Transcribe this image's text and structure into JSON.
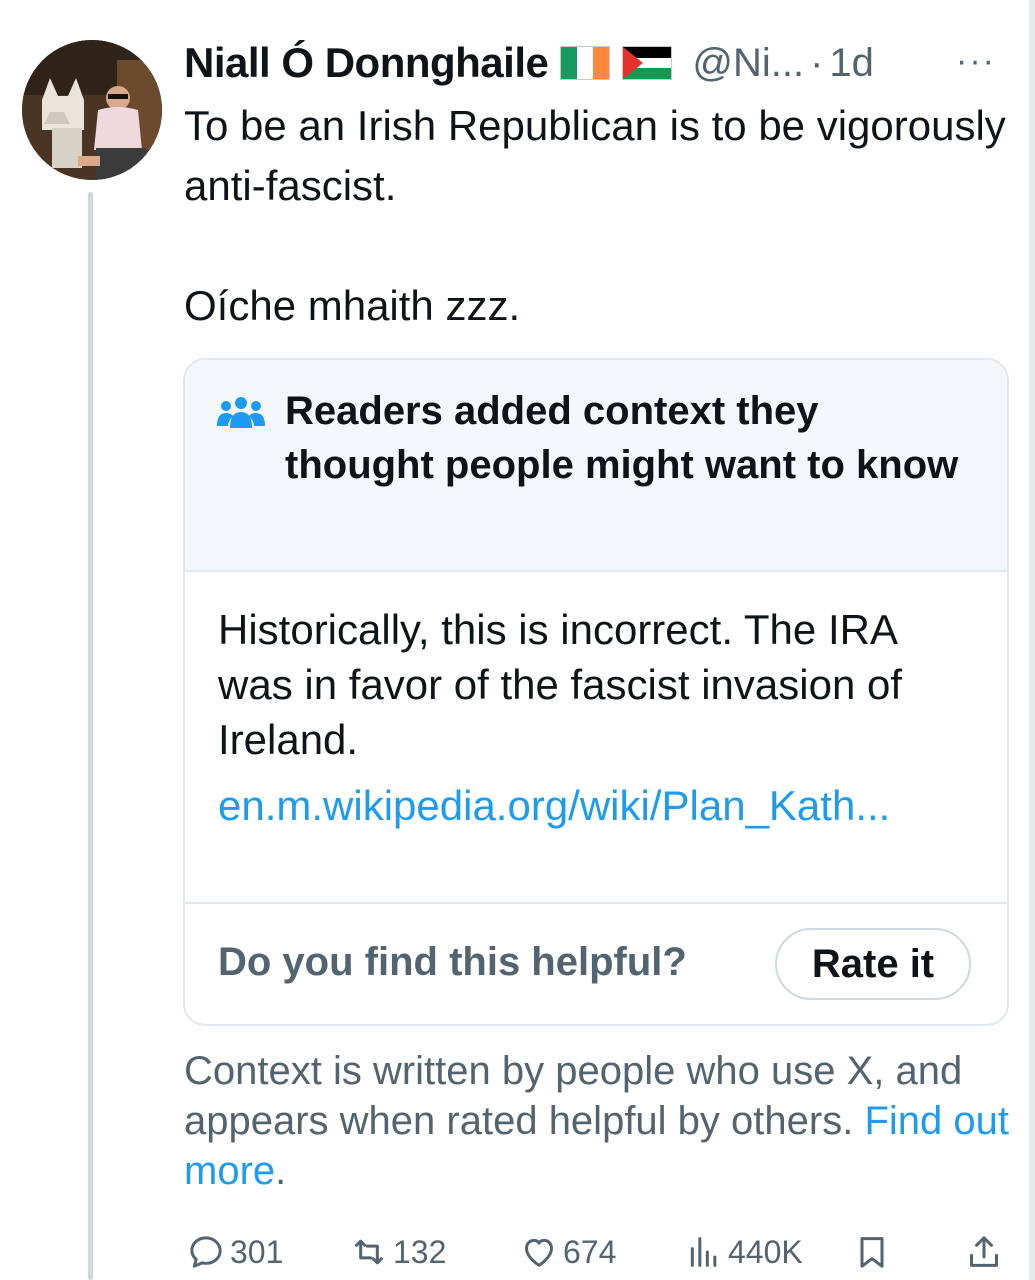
{
  "tweet": {
    "author_name": "Niall Ó Donnghaile",
    "handle": "@Ni...",
    "separator": "·",
    "time": "1d",
    "more_label": "···",
    "flags": [
      "ireland-flag",
      "palestine-flag"
    ],
    "text_line1": "To be an Irish Republican is to be vigorously anti-fascist.",
    "text_line2": "Oíche mhaith zzz."
  },
  "community_note": {
    "header_icon": "people-icon",
    "header_title": "Readers added context they thought people might want to know",
    "body_text": "Historically, this is incorrect. The IRA was in favor of the fascist invasion of Ireland.",
    "link_text": "en.m.wikipedia.org/wiki/Plan_Kath...",
    "helpful_question": "Do you find this helpful?",
    "rate_button_label": "Rate it"
  },
  "context_info": {
    "text": "Context is written by people who use X, and appears when rated helpful by others. ",
    "link_text": "Find out more",
    "trailing": "."
  },
  "actions": {
    "replies": "301",
    "reposts": "132",
    "likes": "674",
    "views": "440K"
  },
  "colors": {
    "link_blue": "#1d9bf0",
    "secondary_text": "#536471",
    "primary_text": "#0f1419",
    "note_header_bg": "#f5f8fa",
    "border": "#e1e8ed"
  }
}
